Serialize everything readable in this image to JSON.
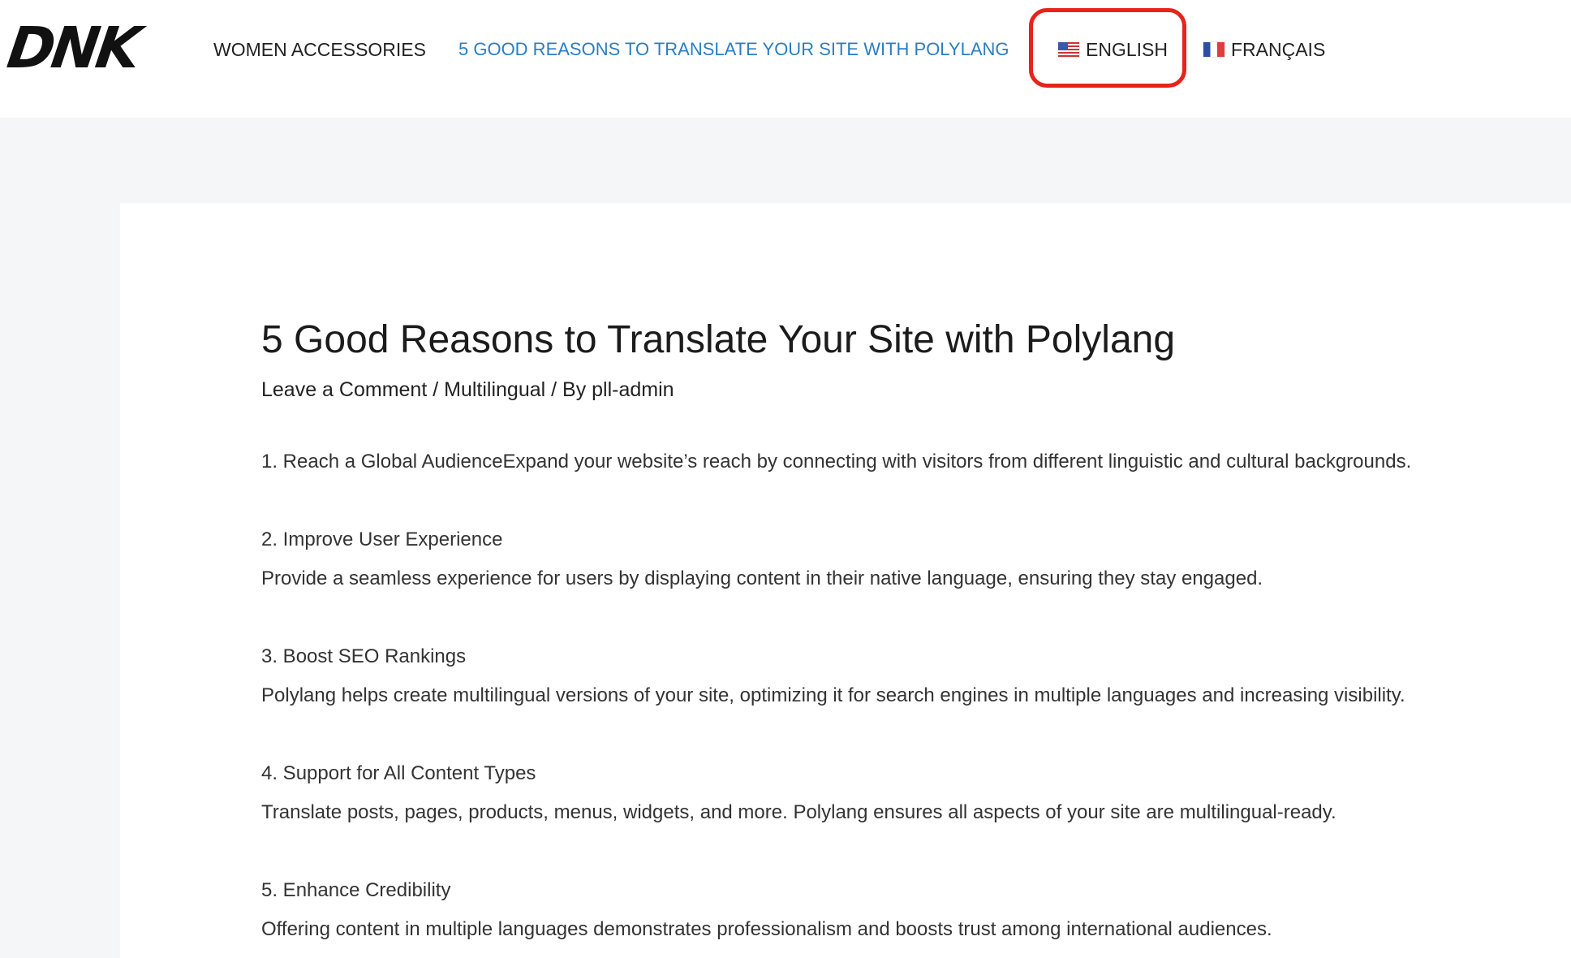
{
  "header": {
    "logo": "DNK",
    "nav": {
      "women_accessories": "WOMEN ACCESSORIES",
      "reasons": "5 GOOD REASONS TO TRANSLATE YOUR SITE WITH POLYLANG",
      "english": "ENGLISH",
      "french": "FRANÇAIS"
    }
  },
  "colors": {
    "active_link": "#2a7ec3",
    "highlight_border": "#e8231a",
    "page_background": "#f5f6f8"
  },
  "article": {
    "title": "5 Good Reasons to Translate Your Site with Polylang",
    "meta": {
      "comment": "Leave a Comment",
      "sep1": " / ",
      "category": "Multilingual",
      "sep2": " / By ",
      "author": "pll-admin"
    },
    "sections": [
      {
        "title": "1. Reach a Global Audience",
        "body": "Expand your website’s reach by connecting with visitors from different linguistic and cultural backgrounds."
      },
      {
        "title": "2. Improve User Experience",
        "body": "Provide a seamless experience for users by displaying content in their native language, ensuring they stay engaged."
      },
      {
        "title": "3. Boost SEO Rankings",
        "body": "Polylang helps create multilingual versions of your site, optimizing it for search engines in multiple languages and increasing visibility."
      },
      {
        "title": "4. Support for All Content Types",
        "body": "Translate posts, pages, products, menus, widgets, and more. Polylang ensures all aspects of your site are multilingual-ready."
      },
      {
        "title": "5. Enhance Credibility",
        "body": "Offering content in multiple languages demonstrates professionalism and boosts trust among international audiences."
      }
    ]
  }
}
